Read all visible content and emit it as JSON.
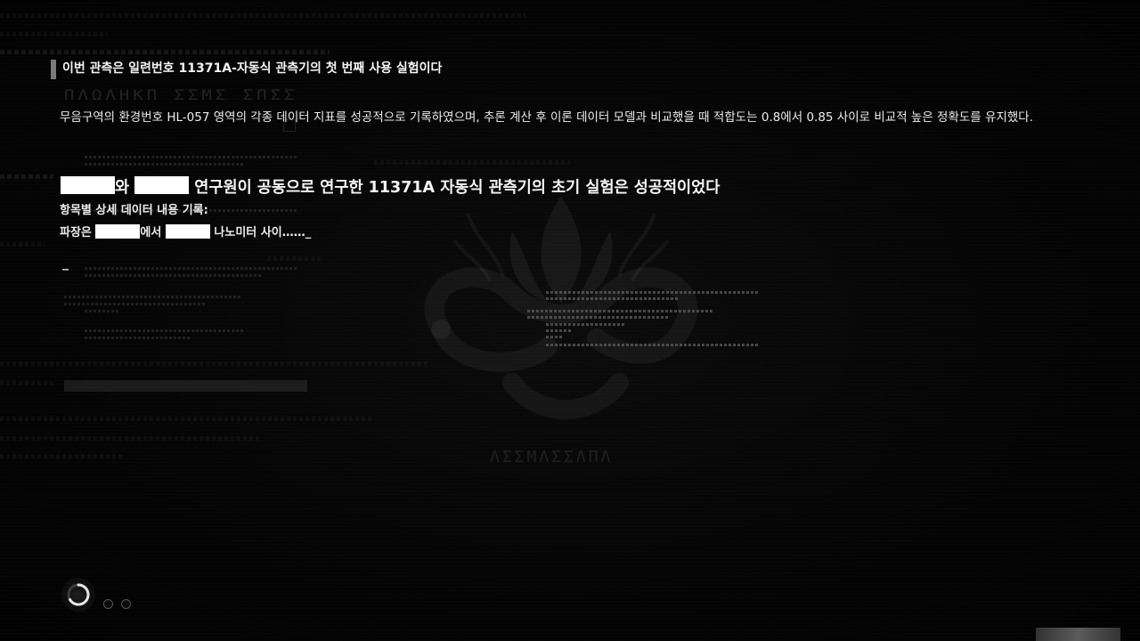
{
  "log": {
    "header": "이번 관측은 일련번호 11371A-자동식 관측기의 첫 번째 사용 실험이다",
    "summary": "무음구역의 환경번호 HL-057 영역의 각종 데이터 지표를 성공적으로 기록하였으며, 추론 계산 후 이론 데이터 모델과 비교했을 때 적합도는 0.8에서 0.85 사이로 비교적 높은 정확도를 유지했다.",
    "headline_part1": "와",
    "headline_part2": "연구원이 공동으로 연구한 11371A 자동식 관측기의 초기 실험은 성공적이었다",
    "detail_label": "항목별 상세 데이터 내용 기록:",
    "wave_prefix": "파장은",
    "wave_mid": "에서",
    "wave_suffix": "나노미터 사이……_",
    "cursor": "_"
  },
  "controls": {
    "loading_icon": "loading-spinner-icon",
    "page_dots": 2
  },
  "colors": {
    "background": "#040404",
    "text": "#f2f2f2",
    "redaction": "#ffffff",
    "accent_bar": "#7a7a7a"
  }
}
